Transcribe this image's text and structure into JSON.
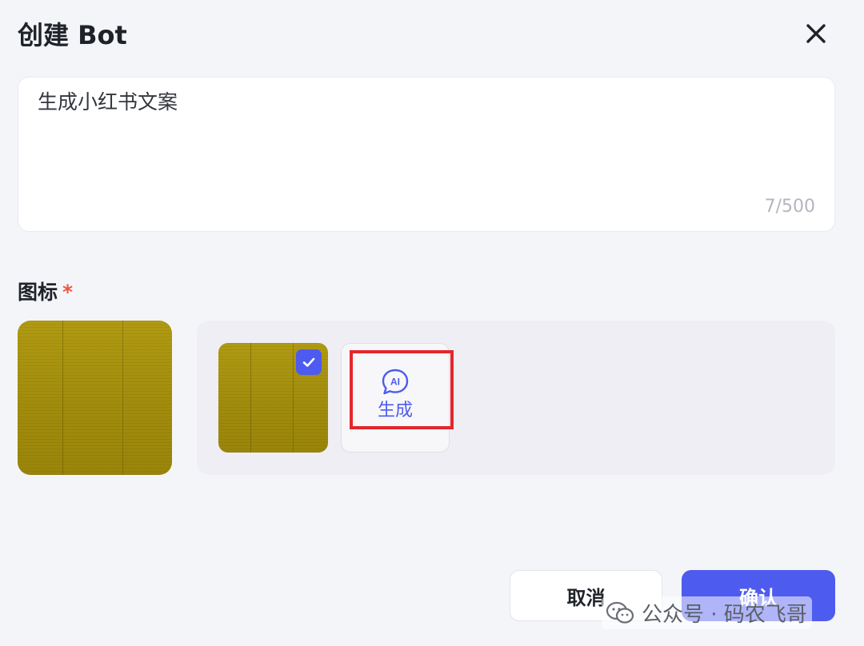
{
  "dialog": {
    "title": "创建 Bot"
  },
  "description": {
    "value": "生成小红书文案",
    "char_count": "7/500"
  },
  "icon_section": {
    "label": "图标",
    "required_mark": "*",
    "ai_generate_label": "生成",
    "ai_icon_text": "AI"
  },
  "footer": {
    "cancel_label": "取消",
    "confirm_label": "确认"
  },
  "watermark": {
    "text": "公众号 · 码农飞哥"
  },
  "colors": {
    "accent": "#4e5bef",
    "highlight": "#e4262b",
    "required": "#f0533f",
    "icon_gold": "#a89211"
  }
}
